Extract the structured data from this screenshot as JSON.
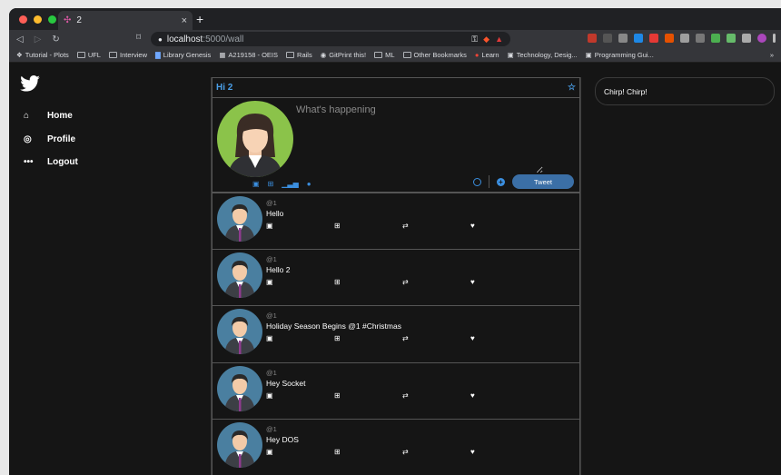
{
  "browser": {
    "tab_title": "2",
    "tab_close": "×",
    "new_tab": "+",
    "url_host": "localhost",
    "url_path": ":5000/wall",
    "bookmarks": [
      "Tutorial - Plots",
      "UFL",
      "Interview",
      "Library Genesis",
      "A219158 - OEIS",
      "Rails",
      "GitPrint this!",
      "ML",
      "Other Bookmarks",
      "Learn",
      "Technology, Desig...",
      "Programming Gui..."
    ],
    "bookmarks_more": "»"
  },
  "sidebar": {
    "items": [
      {
        "label": "Home"
      },
      {
        "label": "Profile"
      },
      {
        "label": "Logout"
      }
    ]
  },
  "feed": {
    "header": "Hi 2",
    "composer": {
      "placeholder": "What's happening",
      "tweet_label": "Tweet"
    },
    "posts": [
      {
        "handle": "@1",
        "text": "Hello"
      },
      {
        "handle": "@1",
        "text": "Hello 2"
      },
      {
        "handle": "@1",
        "text": "Holiday Season Begins @1 #Christmas"
      },
      {
        "handle": "@1",
        "text": "Hey Socket"
      },
      {
        "handle": "@1",
        "text": "Hey DOS"
      }
    ]
  },
  "right_panel": {
    "text": "Chirp! Chirp!"
  },
  "colors": {
    "accent": "#3b8fe0",
    "background": "#151515",
    "border": "#555555"
  }
}
